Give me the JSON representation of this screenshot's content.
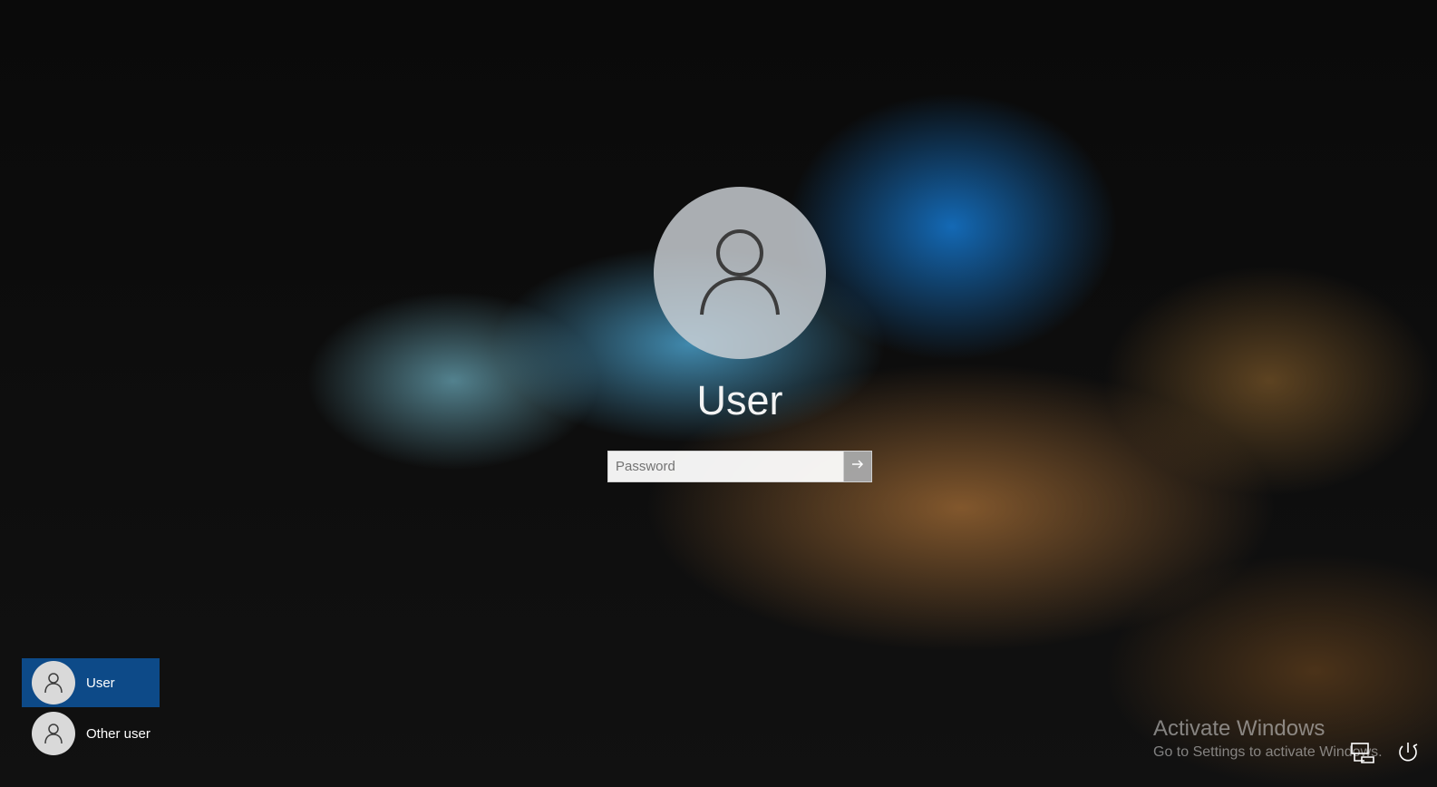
{
  "login": {
    "avatar_icon": "user-silhouette-icon",
    "username": "User",
    "password_placeholder": "Password",
    "submit_icon": "arrow-right-icon"
  },
  "users": [
    {
      "name": "User",
      "selected": true,
      "icon": "user-icon"
    },
    {
      "name": "Other user",
      "selected": false,
      "icon": "user-icon"
    }
  ],
  "watermark": {
    "title": "Activate Windows",
    "subtitle": "Go to Settings to activate Windows."
  },
  "corner_icons": [
    {
      "name": "network-icon"
    },
    {
      "name": "power-icon"
    }
  ],
  "colors": {
    "selected_user_bg": "#0d4a88",
    "avatar_bg": "#cdd2d7",
    "text": "#ffffff"
  }
}
